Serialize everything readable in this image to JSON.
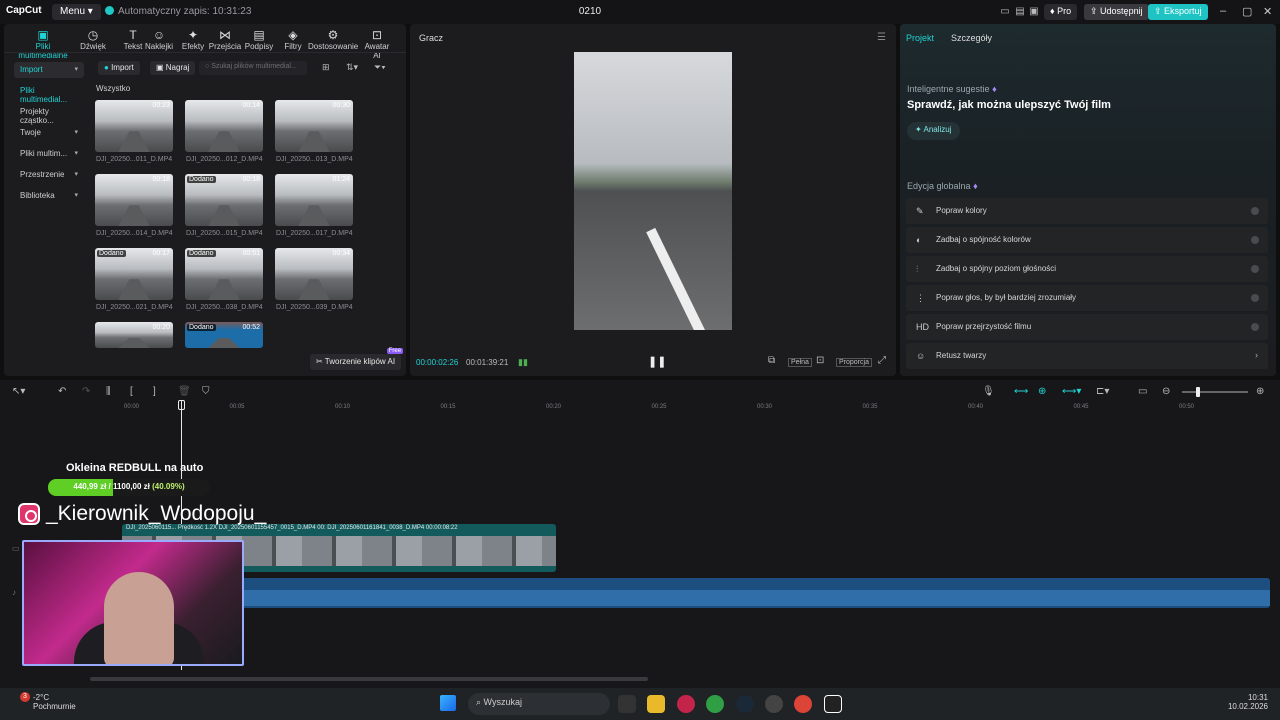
{
  "app": {
    "logo": "CapCut",
    "menu_label": "Menu",
    "autosave": "Automatyczny zapis: 10:31:23",
    "project_name": "0210",
    "pro_label": "Pro",
    "share_label": "Udostępnij",
    "export_label": "Eksportuj"
  },
  "toolbar": [
    {
      "icon": "media-icon",
      "label": "Pliki multimedialne"
    },
    {
      "icon": "audio-icon",
      "label": "Dźwięk"
    },
    {
      "icon": "text-icon",
      "label": "Tekst"
    },
    {
      "icon": "sticker-icon",
      "label": "Naklejki"
    },
    {
      "icon": "effects-icon",
      "label": "Efekty"
    },
    {
      "icon": "transition-icon",
      "label": "Przejścia"
    },
    {
      "icon": "captions-icon",
      "label": "Podpisy"
    },
    {
      "icon": "filters-icon",
      "label": "Filtry"
    },
    {
      "icon": "adjust-icon",
      "label": "Dostosowanie"
    },
    {
      "icon": "avatar-icon",
      "label": "Awatar AI"
    }
  ],
  "sidebar": [
    {
      "label": "Import",
      "chevron": true
    },
    {
      "label": "Pliki multimedial...",
      "chevron": false
    },
    {
      "label": "Projekty cząstko...",
      "chevron": false
    },
    {
      "label": "Twoje",
      "chevron": true
    },
    {
      "label": "Pliki multim...",
      "chevron": true
    },
    {
      "label": "Przestrzenie",
      "chevron": true
    },
    {
      "label": "Biblioteka",
      "chevron": true
    }
  ],
  "media": {
    "import_btn": "Import",
    "record_btn": "Nagraj",
    "search_placeholder": "Szukaj plików multimedial...",
    "filter_label": "Wszystko",
    "added_label": "Dodano",
    "items": [
      {
        "name": "DJI_20250...011_D.MP4",
        "dur": "00:23",
        "added": false
      },
      {
        "name": "DJI_20250...012_D.MP4",
        "dur": "00:14",
        "added": false
      },
      {
        "name": "DJI_20250...013_D.MP4",
        "dur": "00:30",
        "added": false
      },
      {
        "name": "DJI_20250...014_D.MP4",
        "dur": "00:18",
        "added": false
      },
      {
        "name": "DJI_20250...015_D.MP4",
        "dur": "00:18",
        "added": true
      },
      {
        "name": "DJI_20250...017_D.MP4",
        "dur": "01:24",
        "added": false
      },
      {
        "name": "DJI_20250...021_D.MP4",
        "dur": "00:17",
        "added": true
      },
      {
        "name": "DJI_20250...038_D.MP4",
        "dur": "00:51",
        "added": true
      },
      {
        "name": "DJI_20250...039_D.MP4",
        "dur": "00:34",
        "added": false
      },
      {
        "name": "",
        "dur": "00:20",
        "added": false
      },
      {
        "name": "",
        "dur": "00:52",
        "added": true
      }
    ],
    "ai_clip_btn": "Tworzenie klipów AI",
    "free_badge": "Free"
  },
  "player": {
    "title": "Gracz",
    "current_time": "00:00:02:26",
    "total_time": "00:01:39:21",
    "full_label": "Pełna",
    "ratio_label": "Proporcja"
  },
  "props": {
    "tab_project": "Projekt",
    "tab_details": "Szczegóły",
    "suggestions_title": "Inteligentne sugestie",
    "suggestions_head": "Sprawdź, jak można ulepszyć Twój film",
    "analyze_btn": "Analizuj",
    "global_title": "Edycja globalna",
    "global_items": [
      {
        "icon": "wand-icon",
        "label": "Popraw kolory"
      },
      {
        "icon": "palette-icon",
        "label": "Zadbaj o spójność kolorów"
      },
      {
        "icon": "levels-icon",
        "label": "Zadbaj o spójny poziom głośności"
      },
      {
        "icon": "voice-icon",
        "label": "Popraw głos, by był bardziej zrozumiały"
      },
      {
        "icon": "hd-icon",
        "label": "Popraw przejrzystość filmu"
      },
      {
        "icon": "face-icon",
        "label": "Retusz twarzy"
      }
    ]
  },
  "timeline": {
    "ruler": [
      "00:00",
      "00:05",
      "00:10",
      "00:15",
      "00:20",
      "00:25",
      "00:30",
      "00:35",
      "00:40",
      "00:45",
      "00:50"
    ],
    "clip_label": "DJI_2025060115...  Prędkość 1.2X  DJI_20250601155457_0015_D.MP4  00:  DJI_20250601161841_0038_D.MP4  00:00:08:22"
  },
  "overlay": {
    "title": "Okleina REDBULL na auto",
    "progress_text": "440,99 zł / 1100,00 zł",
    "progress_pct_text": "(40.09%)",
    "progress_value": 0.4009,
    "handle": "_Kierownik_Wodopoju_"
  },
  "taskbar": {
    "weather_badge": "3",
    "temp": "-2°C",
    "weather": "Pochmurnie",
    "search": "Wyszukaj",
    "time": "10:31",
    "date": "10.02.2026"
  }
}
